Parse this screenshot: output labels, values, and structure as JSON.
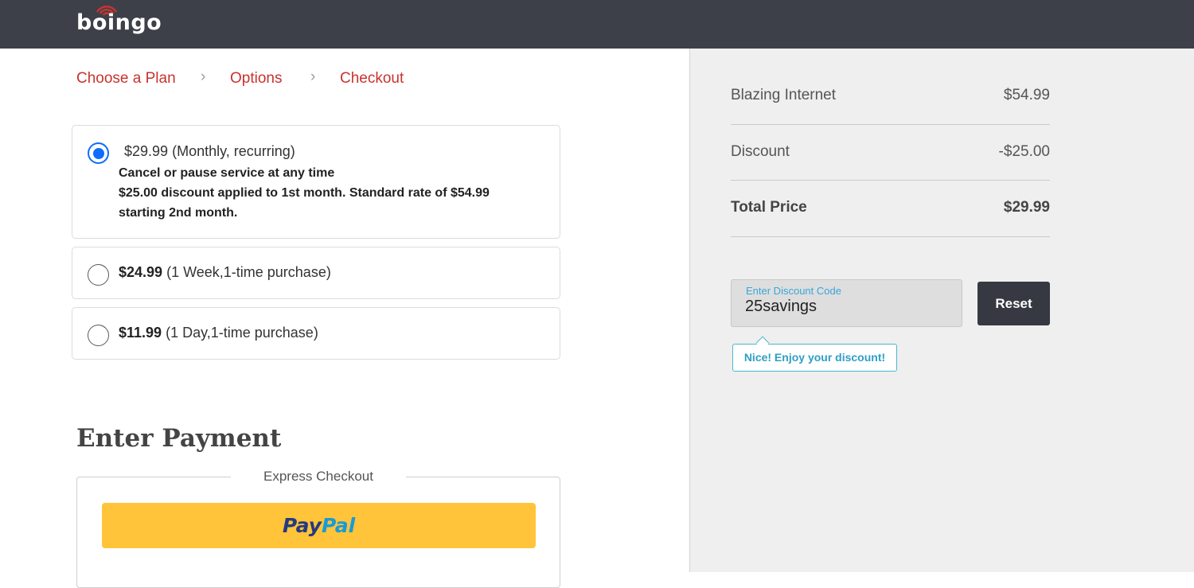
{
  "header": {
    "logo_text": "boingo"
  },
  "breadcrumb": {
    "steps": [
      "Choose a Plan",
      "Options",
      "Checkout"
    ]
  },
  "plans": [
    {
      "price": "$29.99",
      "term": "(Monthly, recurring)",
      "details": [
        "Cancel or pause service at any time",
        "$25.00 discount applied to 1st month. Standard rate of $54.99",
        "starting 2nd month."
      ],
      "selected": true
    },
    {
      "price": "$24.99",
      "term": "(1 Week,1-time purchase)",
      "selected": false
    },
    {
      "price": "$11.99",
      "term": "(1 Day,1-time purchase)",
      "selected": false
    }
  ],
  "payment": {
    "title": "Enter Payment",
    "express_label": "Express Checkout",
    "paypal_part1": "Pay",
    "paypal_part2": "Pal"
  },
  "summary": {
    "item_label": "Blazing Internet",
    "item_price": "$54.99",
    "discount_label": "Discount",
    "discount_value": "-$25.00",
    "total_label": "Total Price",
    "total_value": "$29.99"
  },
  "discount_code": {
    "label": "Enter Discount Code",
    "value": "25savings",
    "reset_label": "Reset",
    "success_message": "Nice! Enjoy your discount!"
  },
  "colors": {
    "header_bg": "#3d4049",
    "accent_red": "#c8332f",
    "radio_blue": "#0d6efd",
    "paypal_yellow": "#ffc439",
    "tooltip_teal": "#4db6cf"
  }
}
